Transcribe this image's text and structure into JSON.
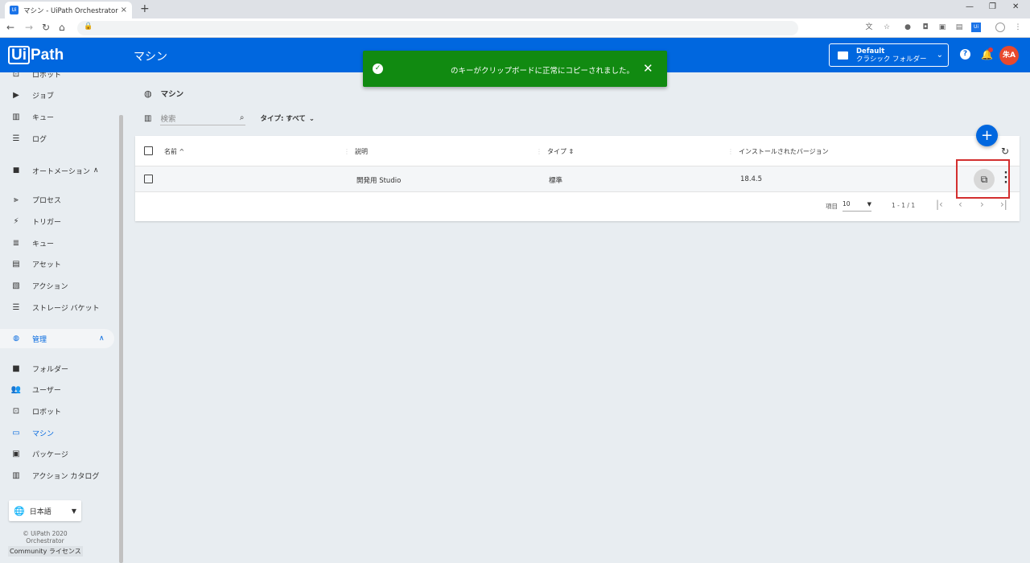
{
  "browser": {
    "tab_title": "マシン - UiPath Orchestrator",
    "tab_favicon": "Ui",
    "tab_close": "×",
    "new_tab": "+",
    "minimize": "—",
    "restore": "❐",
    "close": "✕"
  },
  "header": {
    "logo_ui": "Ui",
    "logo_path": "Path",
    "title": "マシン",
    "folder_name": "Default",
    "folder_type": "クラシック フォルダー",
    "avatar_initials": "朱A"
  },
  "toast": {
    "message": "のキーがクリップボードに正常にコピーされました。",
    "check": "✓",
    "close": "✕"
  },
  "sidebar": {
    "items_top": [
      {
        "label": "ロボット",
        "icon": "robot-icon"
      },
      {
        "label": "ジョブ",
        "icon": "play-circle-icon"
      },
      {
        "label": "キュー",
        "icon": "chart-icon"
      },
      {
        "label": "ログ",
        "icon": "list-icon"
      }
    ],
    "automation": {
      "label": "オートメーション",
      "icon": "folder-icon"
    },
    "automation_items": [
      {
        "label": "プロセス",
        "icon": "hierarchy-icon"
      },
      {
        "label": "トリガー",
        "icon": "bolt-icon"
      },
      {
        "label": "キュー",
        "icon": "queue-icon"
      },
      {
        "label": "アセット",
        "icon": "asset-icon"
      },
      {
        "label": "アクション",
        "icon": "clipboard-icon"
      },
      {
        "label": "ストレージ バケット",
        "icon": "storage-icon"
      }
    ],
    "admin": {
      "label": "管理",
      "icon": "globe-icon"
    },
    "admin_items": [
      {
        "label": "フォルダー",
        "icon": "folder-icon"
      },
      {
        "label": "ユーザー",
        "icon": "users-icon"
      },
      {
        "label": "ロボット",
        "icon": "robot-icon"
      },
      {
        "label": "マシン",
        "icon": "monitor-icon"
      },
      {
        "label": "パッケージ",
        "icon": "package-icon"
      },
      {
        "label": "アクション カタログ",
        "icon": "catalog-icon"
      }
    ],
    "language": "日本語",
    "copyright_line1": "© UiPath 2020",
    "copyright_line2": "Orchestrator",
    "license_prefix": "Community",
    "license_suffix": "ライセンス"
  },
  "main": {
    "breadcrumb": "マシン",
    "search_placeholder": "検索",
    "type_filter": "タイプ: すべて",
    "columns": {
      "name": "名前",
      "description": "説明",
      "type": "タイプ",
      "version": "インストールされたバージョン"
    },
    "rows": [
      {
        "name": "",
        "description": "開発用 Studio",
        "type": "標準",
        "version": "18.4.5"
      }
    ],
    "pager": {
      "items_label": "項目",
      "page_size": "10",
      "range": "1 - 1 / 1"
    }
  },
  "colors": {
    "brand": "#0067df",
    "toast": "#118a11",
    "avatar": "#e8492d",
    "highlight": "#d32f2f"
  }
}
